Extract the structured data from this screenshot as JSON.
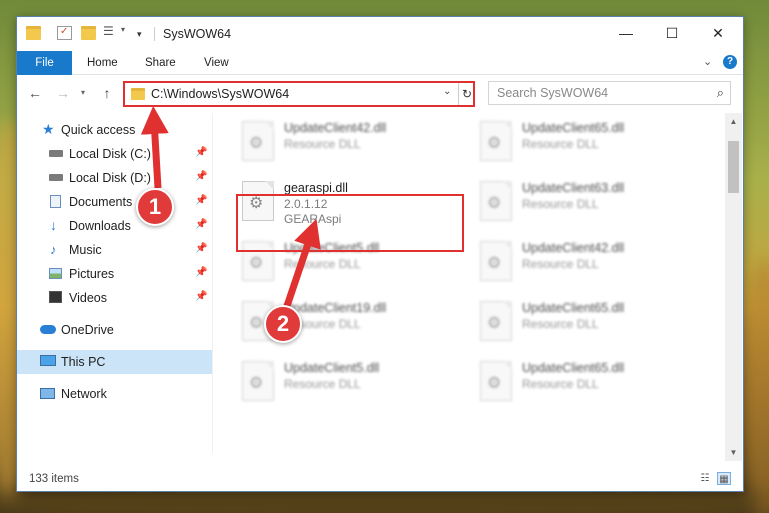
{
  "window": {
    "title": "SysWOW64",
    "controls": {
      "minimize": "—",
      "maximize": "☐",
      "close": "✕"
    }
  },
  "ribbon": {
    "tabs": [
      {
        "label": "File",
        "active": true
      },
      {
        "label": "Home"
      },
      {
        "label": "Share"
      },
      {
        "label": "View"
      }
    ]
  },
  "nav": {
    "address": "C:\\Windows\\SysWOW64",
    "search_placeholder": "Search SysWOW64"
  },
  "sidebar": {
    "items": [
      {
        "label": "Quick access",
        "icon": "star-icon",
        "pinned": false
      },
      {
        "label": "Local Disk (C:)",
        "icon": "drive-icon",
        "pinned": true
      },
      {
        "label": "Local Disk (D:)",
        "icon": "drive-icon",
        "pinned": true
      },
      {
        "label": "Documents",
        "icon": "documents-icon",
        "pinned": true
      },
      {
        "label": "Downloads",
        "icon": "download-icon",
        "pinned": true
      },
      {
        "label": "Music",
        "icon": "music-icon",
        "pinned": true
      },
      {
        "label": "Pictures",
        "icon": "pictures-icon",
        "pinned": true
      },
      {
        "label": "Videos",
        "icon": "videos-icon",
        "pinned": true
      },
      {
        "label": "OneDrive",
        "icon": "cloud-icon",
        "pinned": false
      },
      {
        "label": "This PC",
        "icon": "computer-icon",
        "pinned": false,
        "selected": true
      },
      {
        "label": "Network",
        "icon": "network-icon",
        "pinned": false
      }
    ]
  },
  "files": {
    "left": [
      {
        "name": "UpdateClient42.dll",
        "line2": "Resource DLL"
      },
      {
        "name": "gearaspi.dll",
        "line2": "2.0.1.12",
        "line3": "GEARAspi",
        "highlighted": true
      },
      {
        "name": "UpdateClient5.dll",
        "line2": "Resource DLL"
      },
      {
        "name": "UpdateClient19.dll",
        "line2": "Resource DLL"
      },
      {
        "name": "UpdateClient5.dll",
        "line2": "Resource DLL"
      }
    ],
    "right": [
      {
        "name": "UpdateClient65.dll",
        "line2": "Resource DLL"
      },
      {
        "name": "UpdateClient63.dll",
        "line2": "Resource DLL"
      },
      {
        "name": "UpdateClient42.dll",
        "line2": "Resource DLL"
      },
      {
        "name": "UpdateClient65.dll",
        "line2": "Resource DLL"
      },
      {
        "name": "UpdateClient65.dll",
        "line2": "Resource DLL"
      }
    ]
  },
  "status": {
    "item_count": "133 items"
  },
  "annotations": {
    "step1": "1",
    "step2": "2",
    "color": "#e03030"
  }
}
